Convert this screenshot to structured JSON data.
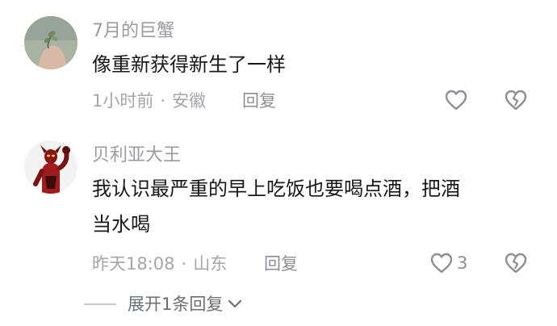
{
  "comments": [
    {
      "username": "7月的巨蟹",
      "text": "像重新获得新生了一样",
      "time": "1小时前",
      "location": "安徽",
      "reply_label": "回复",
      "like_count": "",
      "avatar_icon": "hand-holding-plant-avatar",
      "like_icon": "heart-outline-icon",
      "dislike_icon": "broken-heart-icon"
    },
    {
      "username": "贝利亚大王",
      "text_lines": [
        "我认识最严重的早上吃饭也要喝点酒，把酒",
        "当水喝"
      ],
      "time": "昨天18:08",
      "location": "山东",
      "reply_label": "回复",
      "like_count": "3",
      "avatar_icon": "belial-ultraman-avatar",
      "like_icon": "heart-outline-icon",
      "dislike_icon": "broken-heart-icon"
    }
  ],
  "meta_separator": "·",
  "expand_replies": {
    "label": "展开1条回复",
    "icon": "chevron-down-icon"
  },
  "colors": {
    "username": "#9a9ba2",
    "text": "#17181c",
    "meta": "#a5a6ad",
    "icon": "#8e8f96"
  }
}
